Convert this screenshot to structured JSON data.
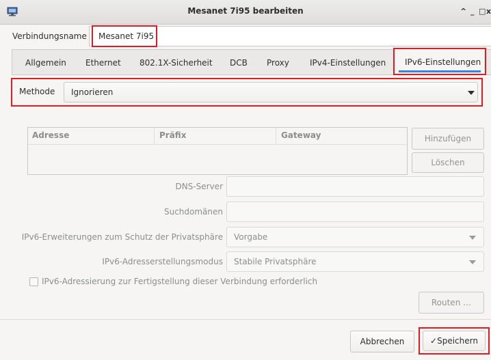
{
  "window": {
    "title": "Mesanet 7i95 bearbeiten",
    "controls": {
      "maximize": "^",
      "minimize": "_",
      "restore": "□",
      "close": "x"
    }
  },
  "connection": {
    "name_label": "Verbindungsname",
    "name_value": "Mesanet 7i95"
  },
  "tabs": [
    {
      "label": "Allgemein"
    },
    {
      "label": "Ethernet"
    },
    {
      "label": "802.1X-Sicherheit"
    },
    {
      "label": "DCB"
    },
    {
      "label": "Proxy"
    },
    {
      "label": "IPv4-Einstellungen"
    },
    {
      "label": "IPv6-Einstellungen",
      "selected": true
    }
  ],
  "method": {
    "label": "Methode",
    "value": "Ignorieren"
  },
  "addresses": {
    "columns": [
      "Adresse",
      "Präfix",
      "Gateway"
    ],
    "add_button": "Hinzufügen",
    "delete_button": "Löschen"
  },
  "form": {
    "dns_label": "DNS-Server",
    "dns_value": "",
    "search_label": "Suchdomänen",
    "search_value": "",
    "privacy_label": "IPv6-Erweiterungen zum Schutz der Privatsphäre",
    "privacy_value": "Vorgabe",
    "addrgen_label": "IPv6-Adresserstellungsmodus",
    "addrgen_value": "Stabile Privatsphäre",
    "required_label": "IPv6-Adressierung zur Fertigstellung dieser Verbindung erforderlich",
    "required_checked": false,
    "routes_button": "Routen …"
  },
  "actions": {
    "cancel": "Abbrechen",
    "save_check": "✓",
    "save": "Speichern"
  },
  "colors": {
    "highlight": "#e01b24",
    "tab_underline": "#3584e4"
  },
  "icons": {
    "app": "network-connection-icon",
    "dropdown": "caret-down-icon",
    "checkmark": "checkmark-icon"
  }
}
